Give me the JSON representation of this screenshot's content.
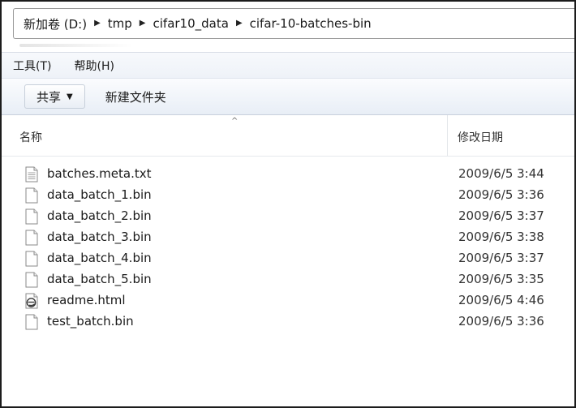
{
  "address": {
    "crumbs": [
      "新加卷 (D:)",
      "tmp",
      "cifar10_data",
      "cifar-10-batches-bin"
    ]
  },
  "menu": {
    "items": [
      "工具(T)",
      "帮助(H)"
    ]
  },
  "toolbar": {
    "share_label": "共享",
    "new_folder_label": "新建文件夹"
  },
  "columns": {
    "name": "名称",
    "date": "修改日期"
  },
  "files": [
    {
      "name": "batches.meta.txt",
      "date": "2009/6/5 3:44",
      "icon": "text-file-icon"
    },
    {
      "name": "data_batch_1.bin",
      "date": "2009/6/5 3:36",
      "icon": "file-icon"
    },
    {
      "name": "data_batch_2.bin",
      "date": "2009/6/5 3:37",
      "icon": "file-icon"
    },
    {
      "name": "data_batch_3.bin",
      "date": "2009/6/5 3:38",
      "icon": "file-icon"
    },
    {
      "name": "data_batch_4.bin",
      "date": "2009/6/5 3:37",
      "icon": "file-icon"
    },
    {
      "name": "data_batch_5.bin",
      "date": "2009/6/5 3:35",
      "icon": "file-icon"
    },
    {
      "name": "readme.html",
      "date": "2009/6/5 4:46",
      "icon": "html-file-icon"
    },
    {
      "name": "test_batch.bin",
      "date": "2009/6/5 3:36",
      "icon": "file-icon"
    }
  ]
}
